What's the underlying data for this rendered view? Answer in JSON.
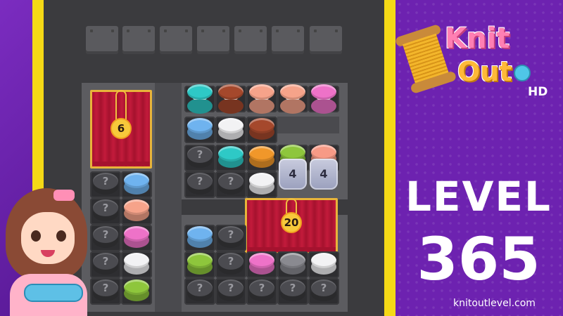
{
  "game": {
    "logo_line1": "Knit",
    "logo_line2": "Out",
    "logo_suffix": "HD",
    "level_label": "LEVEL",
    "level_number": "365",
    "website": "knitoutlevel.com"
  },
  "colors": {
    "background_purple": "#6d22b0",
    "frame_yellow": "#f5d916",
    "board_dark": "#3b3b3e",
    "curtain_red": "#c31b3b"
  },
  "slots": {
    "count": 7
  },
  "curtains": [
    {
      "label": "6"
    },
    {
      "label": "20"
    }
  ],
  "jars": [
    {
      "label": "4"
    },
    {
      "label": "4"
    }
  ],
  "mystery_symbol": "?",
  "spools": {
    "teal": "#2ec9c6",
    "brown": "#a5482c",
    "peach": "#f6a38a",
    "pink": "#ee72c8",
    "blue": "#6fb3ef",
    "white": "#f2f2f4",
    "orange": "#f0972a",
    "lime": "#8ec63c",
    "salmon": "#f79a86",
    "gray": "#8a8a90"
  }
}
